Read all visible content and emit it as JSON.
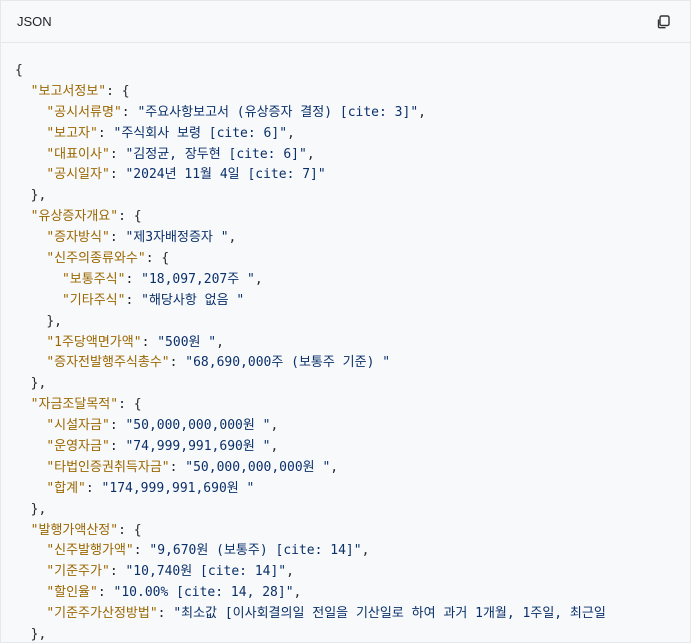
{
  "code_block": {
    "language": "JSON",
    "copy_icon": "copy-icon",
    "lines": [
      {
        "indent": "",
        "punct": "{"
      },
      {
        "indent": "  ",
        "key": "\"보고서정보\"",
        "punct": ": {"
      },
      {
        "indent": "    ",
        "key": "\"공시서류명\"",
        "sep": ": ",
        "value": "\"주요사항보고서 (유상증자 결정) [cite: 3]\"",
        "tail": ","
      },
      {
        "indent": "    ",
        "key": "\"보고자\"",
        "sep": ": ",
        "value": "\"주식회사 보령 [cite: 6]\"",
        "tail": ","
      },
      {
        "indent": "    ",
        "key": "\"대표이사\"",
        "sep": ": ",
        "value": "\"김정균, 장두현 [cite: 6]\"",
        "tail": ","
      },
      {
        "indent": "    ",
        "key": "\"공시일자\"",
        "sep": ": ",
        "value": "\"2024년 11월 4일 [cite: 7]\""
      },
      {
        "indent": "  ",
        "punct": "},"
      },
      {
        "indent": "  ",
        "key": "\"유상증자개요\"",
        "punct": ": {"
      },
      {
        "indent": "    ",
        "key": "\"증자방식\"",
        "sep": ": ",
        "value": "\"제3자배정증자 \"",
        "tail": ","
      },
      {
        "indent": "    ",
        "key": "\"신주의종류와수\"",
        "punct": ": {"
      },
      {
        "indent": "      ",
        "key": "\"보통주식\"",
        "sep": ": ",
        "value": "\"18,097,207주 \"",
        "tail": ","
      },
      {
        "indent": "      ",
        "key": "\"기타주식\"",
        "sep": ": ",
        "value": "\"해당사항 없음 \""
      },
      {
        "indent": "    ",
        "punct": "},"
      },
      {
        "indent": "    ",
        "key": "\"1주당액면가액\"",
        "sep": ": ",
        "value": "\"500원 \"",
        "tail": ","
      },
      {
        "indent": "    ",
        "key": "\"증자전발행주식총수\"",
        "sep": ": ",
        "value": "\"68,690,000주 (보통주 기준) \""
      },
      {
        "indent": "  ",
        "punct": "},"
      },
      {
        "indent": "  ",
        "key": "\"자금조달목적\"",
        "punct": ": {"
      },
      {
        "indent": "    ",
        "key": "\"시설자금\"",
        "sep": ": ",
        "value": "\"50,000,000,000원 \"",
        "tail": ","
      },
      {
        "indent": "    ",
        "key": "\"운영자금\"",
        "sep": ": ",
        "value": "\"74,999,991,690원 \"",
        "tail": ","
      },
      {
        "indent": "    ",
        "key": "\"타법인증권취득자금\"",
        "sep": ": ",
        "value": "\"50,000,000,000원 \"",
        "tail": ","
      },
      {
        "indent": "    ",
        "key": "\"합계\"",
        "sep": ": ",
        "value": "\"174,999,991,690원 \""
      },
      {
        "indent": "  ",
        "punct": "},"
      },
      {
        "indent": "  ",
        "key": "\"발행가액산정\"",
        "punct": ": {"
      },
      {
        "indent": "    ",
        "key": "\"신주발행가액\"",
        "sep": ": ",
        "value": "\"9,670원 (보통주) [cite: 14]\"",
        "tail": ","
      },
      {
        "indent": "    ",
        "key": "\"기준주가\"",
        "sep": ": ",
        "value": "\"10,740원 [cite: 14]\"",
        "tail": ","
      },
      {
        "indent": "    ",
        "key": "\"할인율\"",
        "sep": ": ",
        "value": "\"10.00% [cite: 14, 28]\"",
        "tail": ","
      },
      {
        "indent": "    ",
        "key": "\"기준주가산정방법\"",
        "sep": ": ",
        "value": "\"최소값 [이사회결의일 전일을 기산일로 하여 과거 1개월, 1주일, 최근일"
      },
      {
        "indent": "  ",
        "punct": "},"
      }
    ]
  }
}
